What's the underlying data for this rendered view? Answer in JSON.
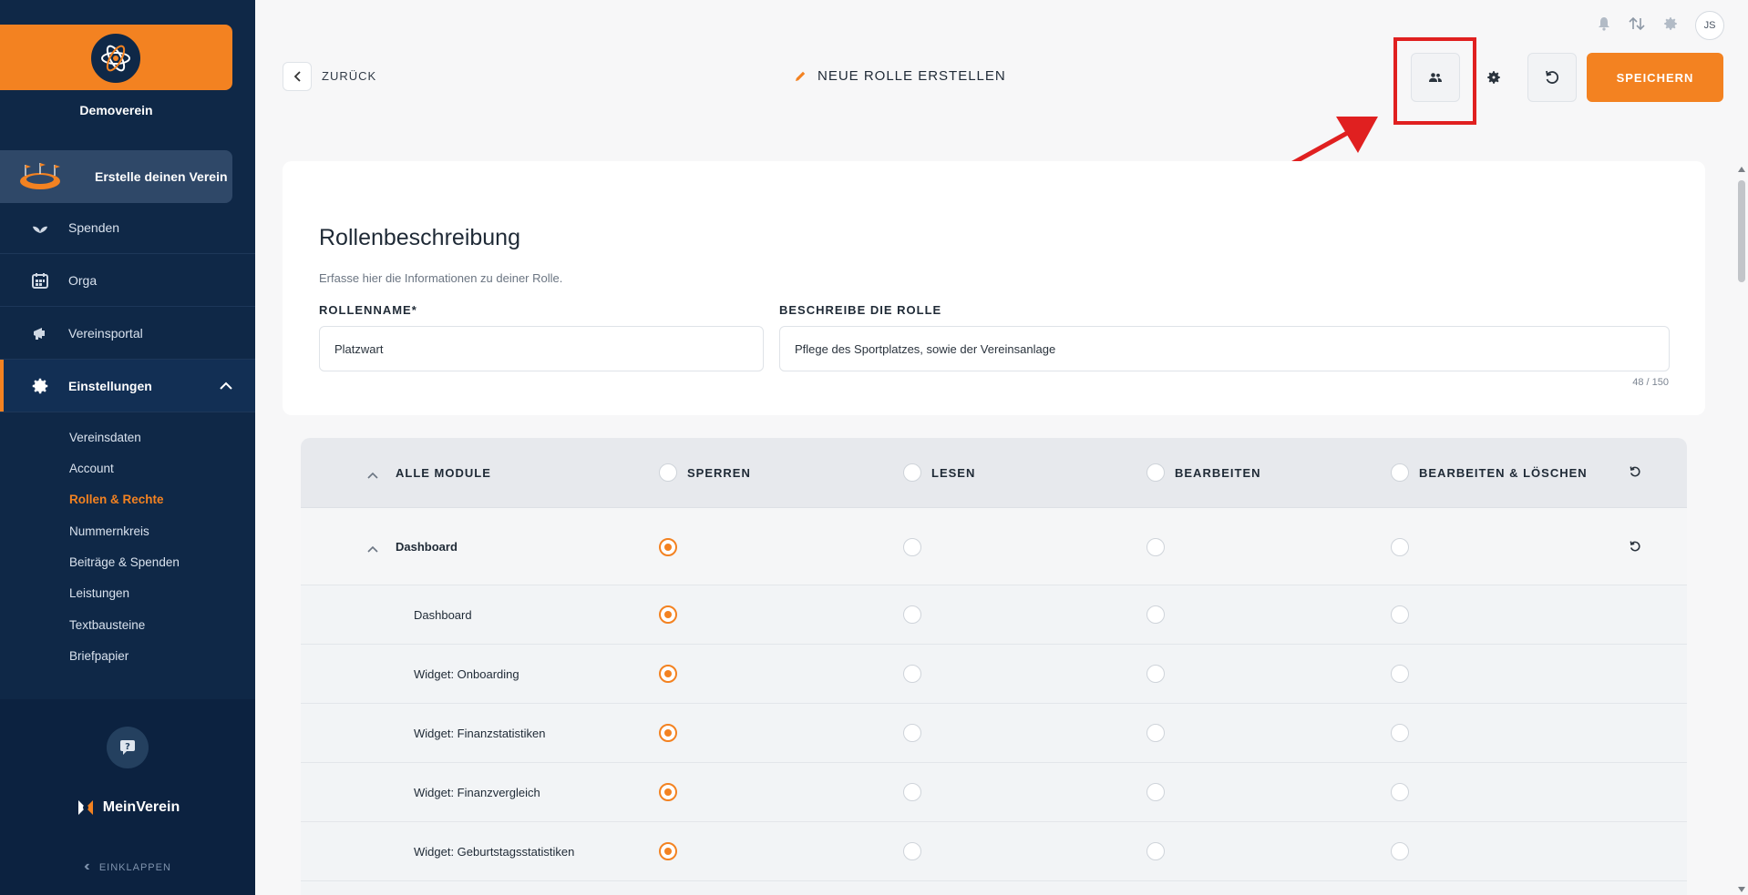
{
  "sidebar": {
    "org_name": "Demoverein",
    "create_banner": "Erstelle deinen Verein",
    "nav": [
      {
        "label": "Spenden",
        "icon": "plant-icon"
      },
      {
        "label": "Orga",
        "icon": "calendar-icon"
      },
      {
        "label": "Vereinsportal",
        "icon": "megaphone-icon"
      },
      {
        "label": "Einstellungen",
        "icon": "gear-icon"
      }
    ],
    "sub_items": [
      "Vereinsdaten",
      "Account",
      "Rollen & Rechte",
      "Nummernkreis",
      "Beiträge & Spenden",
      "Leistungen",
      "Textbausteine",
      "Briefpapier"
    ],
    "brand": "MeinVerein",
    "collapse_label": "EINKLAPPEN"
  },
  "topbar": {
    "avatar_initials": "JS"
  },
  "header": {
    "back_label": "ZURÜCK",
    "title": "NEUE ROLLE ERSTELLEN",
    "save_label": "SPEICHERN"
  },
  "card": {
    "title": "Rollenbeschreibung",
    "description": "Erfasse hier die Informationen zu deiner Rolle.",
    "role_name_label": "ROLLENNAME*",
    "role_name_value": "Platzwart",
    "role_desc_label": "BESCHREIBE DIE ROLLE",
    "role_desc_value": "Pflege des Sportplatzes, sowie der Vereinsanlage",
    "counter": "48 / 150"
  },
  "table": {
    "all_modules_label": "ALLE MODULE",
    "columns": [
      "SPERREN",
      "LESEN",
      "BEARBEITEN",
      "BEARBEITEN & LÖSCHEN"
    ],
    "group": {
      "label": "Dashboard",
      "selected": 0
    },
    "rows": [
      {
        "label": "Dashboard",
        "selected": 0
      },
      {
        "label": "Widget: Onboarding",
        "selected": 0
      },
      {
        "label": "Widget: Finanzstatistiken",
        "selected": 0
      },
      {
        "label": "Widget: Finanzvergleich",
        "selected": 0
      },
      {
        "label": "Widget: Geburtstagsstatistiken",
        "selected": 0
      }
    ]
  },
  "colors": {
    "accent": "#f38221",
    "sidebar_bg": "#0f2847",
    "annotation": "#e02020"
  }
}
